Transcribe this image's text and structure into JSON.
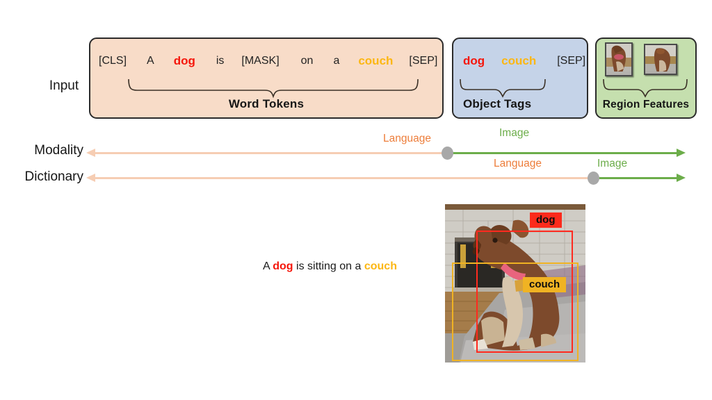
{
  "input": {
    "label": "Input",
    "word_tokens": {
      "tokens": [
        {
          "text": "[CLS]",
          "style": "plain"
        },
        {
          "text": "A",
          "style": "plain"
        },
        {
          "text": "dog",
          "style": "red-bold"
        },
        {
          "text": "is",
          "style": "plain"
        },
        {
          "text": "[MASK]",
          "style": "plain"
        },
        {
          "text": "on",
          "style": "plain"
        },
        {
          "text": "a",
          "style": "plain"
        },
        {
          "text": "couch",
          "style": "orange-bold"
        },
        {
          "text": "[SEP]",
          "style": "plain"
        }
      ],
      "group_label": "Word Tokens",
      "fill_color": "#f8dcc8"
    },
    "object_tags": {
      "tokens": [
        {
          "text": "dog",
          "style": "red-bold"
        },
        {
          "text": "couch",
          "style": "orange-bold"
        },
        {
          "text": "[SEP]",
          "style": "plain"
        }
      ],
      "group_label": "Object Tags",
      "fill_color": "#c5d3e8"
    },
    "region_features": {
      "group_label": "Region Features",
      "thumbnails": [
        "region-thumbnail-dog-head",
        "region-thumbnail-dog-body"
      ],
      "fill_color": "#c5dfae"
    }
  },
  "axes": [
    {
      "name": "Modality",
      "language_label": "Language",
      "image_label": "Image",
      "split_percent": 60
    },
    {
      "name": "Dictionary",
      "language_label": "Language",
      "image_label": "Image",
      "split_percent": 85
    }
  ],
  "colors": {
    "language": "#ed7d3a",
    "language_line": "#f6cdb3",
    "image": "#6cad4a",
    "dog": "#f5160b",
    "couch": "#fcb713",
    "knob": "#a8a8a8"
  },
  "example": {
    "caption_prefix": "A ",
    "caption_dog": "dog",
    "caption_middle": " is sitting on a ",
    "caption_couch": "couch",
    "photo_alt": "puppy-sitting-on-couch-photo",
    "boxes": [
      {
        "label": "dog",
        "color": "#fb2a1c"
      },
      {
        "label": "couch",
        "color": "#f0b323"
      }
    ]
  }
}
